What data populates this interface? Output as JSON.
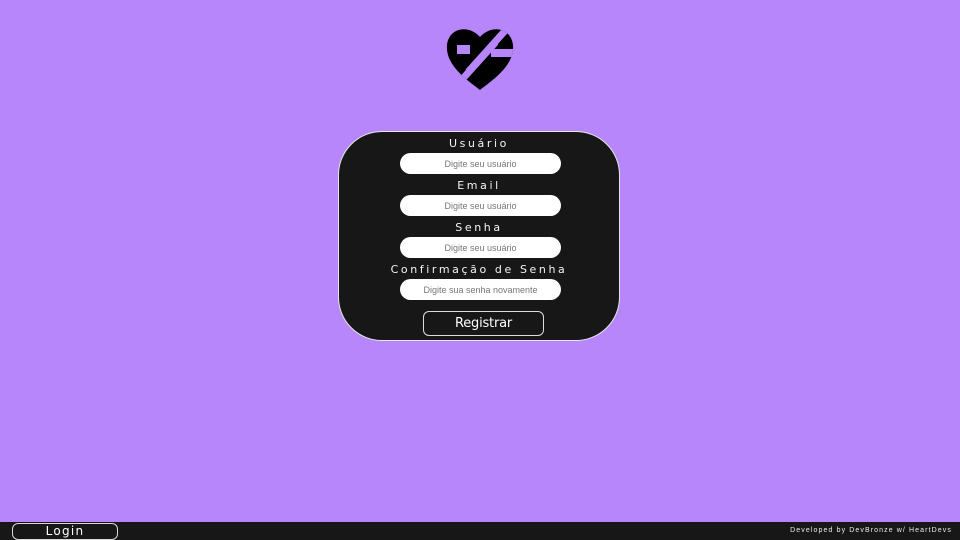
{
  "brand": {
    "logo_icon": "heart-hash-logo-icon"
  },
  "form": {
    "fields": [
      {
        "label": "Usuário",
        "placeholder": "Digite seu usuário",
        "value": ""
      },
      {
        "label": "Email",
        "placeholder": "Digite seu usuário",
        "value": ""
      },
      {
        "label": "Senha",
        "placeholder": "Digite seu usuário",
        "value": ""
      },
      {
        "label": "Confirmação de Senha",
        "placeholder": "Digite sua senha novamente",
        "value": ""
      }
    ],
    "submit_label": "Registrar"
  },
  "footer": {
    "login_label": "Login",
    "credit": "Developed by DevBronze w/ HeartDevs"
  },
  "colors": {
    "background": "#b886fb",
    "card": "#171717",
    "footer": "#171717",
    "input": "#ffffff"
  }
}
